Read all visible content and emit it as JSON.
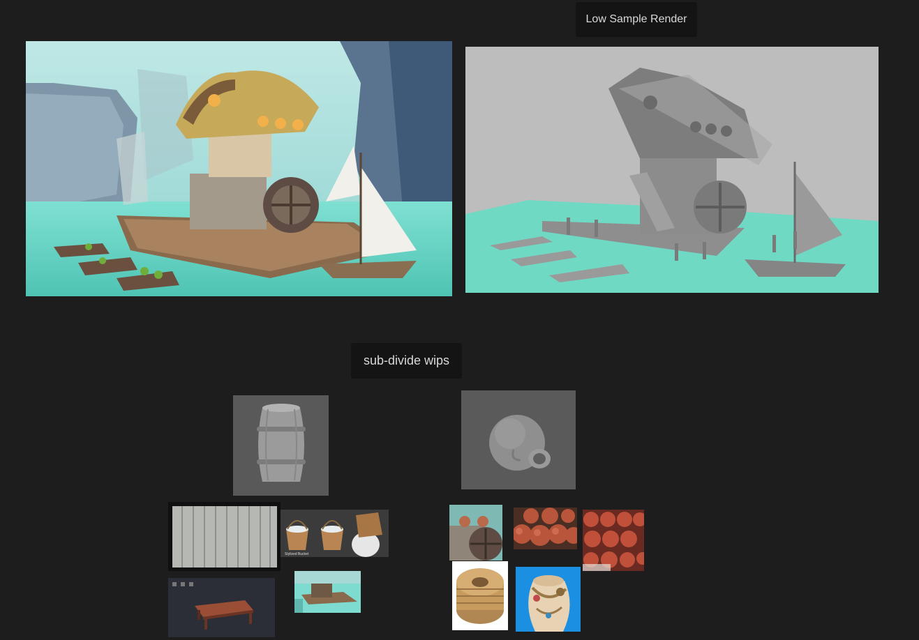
{
  "board": {
    "background": "#1d1d1d",
    "labels": {
      "render": "Low Sample Render",
      "wips": "sub-divide wips"
    }
  },
  "images": {
    "concept": {
      "icon": "concept-painting-image"
    },
    "render": {
      "icon": "grey-render-image"
    },
    "barrel": {
      "icon": "barrel-sculpt-image"
    },
    "pot": {
      "icon": "pot-sculpt-image"
    },
    "planks": {
      "icon": "wood-planks-image"
    },
    "buckets": {
      "icon": "buckets-image",
      "caption": "Stylized Bucket"
    },
    "table": {
      "icon": "table-image"
    },
    "dock": {
      "icon": "dock-crop-image"
    },
    "wheel_ref": {
      "icon": "wheel-reference-image"
    },
    "pots_ref1": {
      "icon": "clay-pots-reference-image"
    },
    "pots_ref2": {
      "icon": "clay-pots-stack-image"
    },
    "rope": {
      "icon": "rope-coil-image"
    },
    "vase": {
      "icon": "rope-vase-image"
    }
  },
  "colors": {
    "water": "#6fd9c4",
    "grey_model": "#8c8c8c",
    "render_bg": "#bdbdbd",
    "label_bg": "#141414"
  }
}
